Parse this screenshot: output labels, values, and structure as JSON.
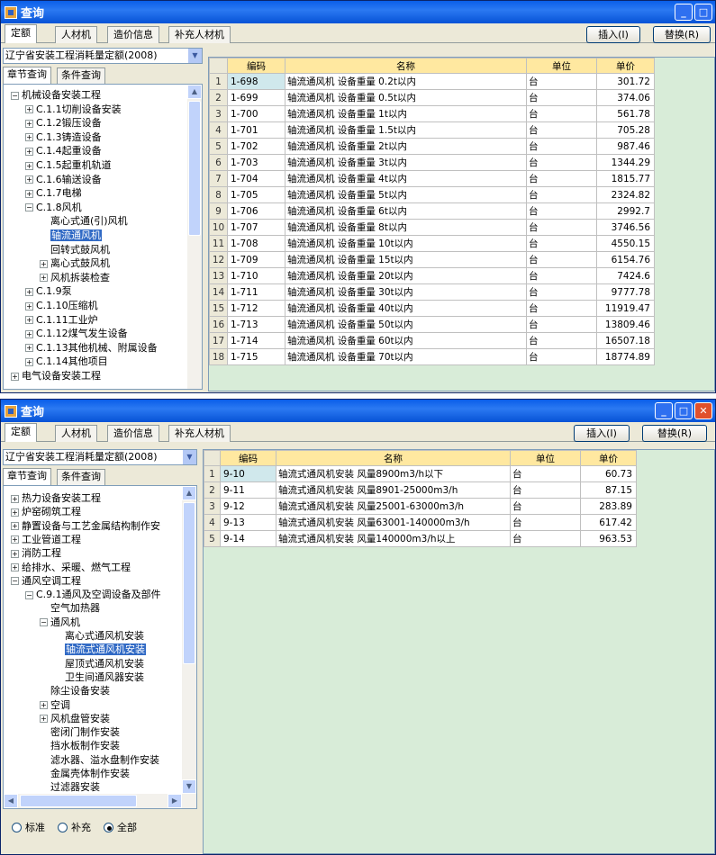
{
  "win1": {
    "title": "查询",
    "tabs": [
      "定额",
      "人材机",
      "造价信息",
      "补充人材机"
    ],
    "insert_label": "插入(I)",
    "replace_label": "替换(R)",
    "quota_select": "辽宁省安装工程消耗量定额(2008)",
    "subtabs": [
      "章节查询",
      "条件查询"
    ],
    "tree": [
      {
        "label": "机械设备安装工程",
        "pm": "−",
        "lvl": 0
      },
      {
        "label": "C.1.1切削设备安装",
        "pm": "+",
        "lvl": 1
      },
      {
        "label": "C.1.2锻压设备",
        "pm": "+",
        "lvl": 1
      },
      {
        "label": "C.1.3铸造设备",
        "pm": "+",
        "lvl": 1
      },
      {
        "label": "C.1.4起重设备",
        "pm": "+",
        "lvl": 1
      },
      {
        "label": "C.1.5起重机轨道",
        "pm": "+",
        "lvl": 1
      },
      {
        "label": "C.1.6输送设备",
        "pm": "+",
        "lvl": 1
      },
      {
        "label": "C.1.7电梯",
        "pm": "+",
        "lvl": 1
      },
      {
        "label": "C.1.8风机",
        "pm": "−",
        "lvl": 1
      },
      {
        "label": "离心式通(引)风机",
        "pm": "",
        "lvl": 2
      },
      {
        "label": "轴流通风机",
        "pm": "",
        "lvl": 2,
        "sel": true
      },
      {
        "label": "回转式鼓风机",
        "pm": "",
        "lvl": 2
      },
      {
        "label": "离心式鼓风机",
        "pm": "+",
        "lvl": 2
      },
      {
        "label": "风机拆装检查",
        "pm": "+",
        "lvl": 2
      },
      {
        "label": "C.1.9泵",
        "pm": "+",
        "lvl": 1
      },
      {
        "label": "C.1.10压缩机",
        "pm": "+",
        "lvl": 1
      },
      {
        "label": "C.1.11工业炉",
        "pm": "+",
        "lvl": 1
      },
      {
        "label": "C.1.12煤气发生设备",
        "pm": "+",
        "lvl": 1
      },
      {
        "label": "C.1.13其他机械、附属设备",
        "pm": "+",
        "lvl": 1
      },
      {
        "label": "C.1.14其他项目",
        "pm": "+",
        "lvl": 1
      },
      {
        "label": "电气设备安装工程",
        "pm": "+",
        "lvl": 0
      }
    ],
    "columns": [
      "编码",
      "名称",
      "单位",
      "单价"
    ],
    "rows": [
      [
        "1",
        "1-698",
        "轴流通风机 设备重量 0.2t以内",
        "台",
        "301.72"
      ],
      [
        "2",
        "1-699",
        "轴流通风机 设备重量 0.5t以内",
        "台",
        "374.06"
      ],
      [
        "3",
        "1-700",
        "轴流通风机 设备重量 1t以内",
        "台",
        "561.78"
      ],
      [
        "4",
        "1-701",
        "轴流通风机 设备重量 1.5t以内",
        "台",
        "705.28"
      ],
      [
        "5",
        "1-702",
        "轴流通风机 设备重量 2t以内",
        "台",
        "987.46"
      ],
      [
        "6",
        "1-703",
        "轴流通风机 设备重量 3t以内",
        "台",
        "1344.29"
      ],
      [
        "7",
        "1-704",
        "轴流通风机 设备重量 4t以内",
        "台",
        "1815.77"
      ],
      [
        "8",
        "1-705",
        "轴流通风机 设备重量 5t以内",
        "台",
        "2324.82"
      ],
      [
        "9",
        "1-706",
        "轴流通风机 设备重量 6t以内",
        "台",
        "2992.7"
      ],
      [
        "10",
        "1-707",
        "轴流通风机 设备重量 8t以内",
        "台",
        "3746.56"
      ],
      [
        "11",
        "1-708",
        "轴流通风机 设备重量 10t以内",
        "台",
        "4550.15"
      ],
      [
        "12",
        "1-709",
        "轴流通风机 设备重量 15t以内",
        "台",
        "6154.76"
      ],
      [
        "13",
        "1-710",
        "轴流通风机 设备重量 20t以内",
        "台",
        "7424.6"
      ],
      [
        "14",
        "1-711",
        "轴流通风机 设备重量 30t以内",
        "台",
        "9777.78"
      ],
      [
        "15",
        "1-712",
        "轴流通风机 设备重量 40t以内",
        "台",
        "11919.47"
      ],
      [
        "16",
        "1-713",
        "轴流通风机 设备重量 50t以内",
        "台",
        "13809.46"
      ],
      [
        "17",
        "1-714",
        "轴流通风机 设备重量 60t以内",
        "台",
        "16507.18"
      ],
      [
        "18",
        "1-715",
        "轴流通风机 设备重量 70t以内",
        "台",
        "18774.89"
      ]
    ]
  },
  "win2": {
    "title": "查询",
    "tabs": [
      "定额",
      "人材机",
      "造价信息",
      "补充人材机"
    ],
    "insert_label": "插入(I)",
    "replace_label": "替换(R)",
    "quota_select": "辽宁省安装工程消耗量定额(2008)",
    "subtabs": [
      "章节查询",
      "条件查询"
    ],
    "tree": [
      {
        "label": "热力设备安装工程",
        "pm": "+",
        "lvl": 0
      },
      {
        "label": "炉窑砌筑工程",
        "pm": "+",
        "lvl": 0
      },
      {
        "label": "静置设备与工艺金属结构制作安",
        "pm": "+",
        "lvl": 0
      },
      {
        "label": "工业管道工程",
        "pm": "+",
        "lvl": 0
      },
      {
        "label": "消防工程",
        "pm": "+",
        "lvl": 0
      },
      {
        "label": "给排水、采暖、燃气工程",
        "pm": "+",
        "lvl": 0
      },
      {
        "label": "通风空调工程",
        "pm": "−",
        "lvl": 0
      },
      {
        "label": "C.9.1通风及空调设备及部件",
        "pm": "−",
        "lvl": 1
      },
      {
        "label": "空气加热器",
        "pm": "",
        "lvl": 2
      },
      {
        "label": "通风机",
        "pm": "−",
        "lvl": 2
      },
      {
        "label": "离心式通风机安装",
        "pm": "",
        "lvl": 3
      },
      {
        "label": "轴流式通风机安装",
        "pm": "",
        "lvl": 3,
        "sel": true
      },
      {
        "label": "屋顶式通风机安装",
        "pm": "",
        "lvl": 3
      },
      {
        "label": "卫生间通风器安装",
        "pm": "",
        "lvl": 3
      },
      {
        "label": "除尘设备安装",
        "pm": "",
        "lvl": 2
      },
      {
        "label": "空调",
        "pm": "+",
        "lvl": 2
      },
      {
        "label": "风机盘管安装",
        "pm": "+",
        "lvl": 2
      },
      {
        "label": "密闭门制作安装",
        "pm": "",
        "lvl": 2
      },
      {
        "label": "挡水板制作安装",
        "pm": "",
        "lvl": 2
      },
      {
        "label": "滤水器、溢水盘制作安装",
        "pm": "",
        "lvl": 2
      },
      {
        "label": "金属壳体制作安装",
        "pm": "",
        "lvl": 2
      },
      {
        "label": "过滤器安装",
        "pm": "",
        "lvl": 2
      }
    ],
    "radios": [
      "标准",
      "补充",
      "全部"
    ],
    "columns": [
      "编码",
      "名称",
      "单位",
      "单价"
    ],
    "rows": [
      [
        "1",
        "9-10",
        "轴流式通风机安装 风量8900m3/h以下",
        "台",
        "60.73"
      ],
      [
        "2",
        "9-11",
        "轴流式通风机安装 风量8901-25000m3/h",
        "台",
        "87.15"
      ],
      [
        "3",
        "9-12",
        "轴流式通风机安装 风量25001-63000m3/h",
        "台",
        "283.89"
      ],
      [
        "4",
        "9-13",
        "轴流式通风机安装 风量63001-140000m3/h",
        "台",
        "617.42"
      ],
      [
        "5",
        "9-14",
        "轴流式通风机安装 风量140000m3/h以上",
        "台",
        "963.53"
      ]
    ]
  }
}
